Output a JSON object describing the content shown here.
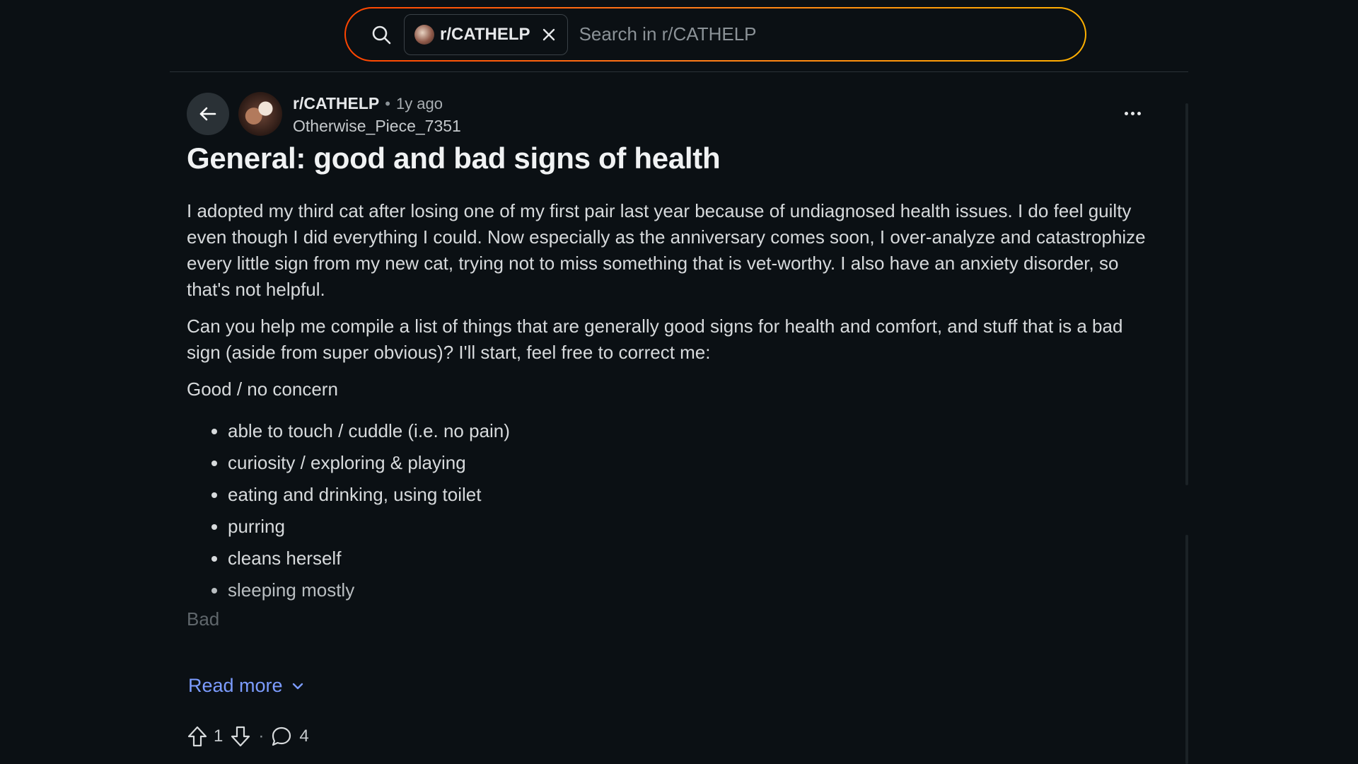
{
  "search": {
    "scope_chip": "r/CATHELP",
    "placeholder": "Search in r/CATHELP"
  },
  "post": {
    "community": "r/CATHELP",
    "age_separator": "•",
    "age": "1y ago",
    "author": "Otherwise_Piece_7351",
    "title": "General: good and bad signs of health",
    "paragraphs": [
      "I adopted my third cat after losing one of my first pair last year because of undiagnosed health issues. I do feel guilty even though I did everything I could. Now especially as the anniversary comes soon, I over-analyze and catastrophize every little sign from my new cat, trying not to miss something that is vet-worthy. I also have an anxiety disorder, so that's not helpful.",
      "Can you help me compile a list of things that are generally good signs for health and comfort, and stuff that is a bad sign (aside from super obvious)? I'll start, feel free to correct me:",
      "Good / no concern"
    ],
    "good_list": [
      "able to touch / cuddle (i.e. no pain)",
      "curiosity / exploring & playing",
      "eating and drinking, using toilet",
      "purring",
      "cleans herself",
      "sleeping mostly"
    ],
    "bad_heading": "Bad",
    "read_more": "Read more",
    "upvotes": "1",
    "separator": "·",
    "comments": "4"
  },
  "icons": {
    "search": "search-icon",
    "close": "close-icon",
    "back": "arrow-left-icon",
    "overflow": "more-horizontal-icon",
    "upvote": "upvote-arrow-icon",
    "downvote": "downvote-arrow-icon",
    "comment": "comment-bubble-icon",
    "chevron": "chevron-down-icon"
  },
  "colors": {
    "background": "#0b1014",
    "accent_link": "#7c9cff",
    "search_border_start": "#ff4500",
    "search_border_end": "#ffb000"
  }
}
